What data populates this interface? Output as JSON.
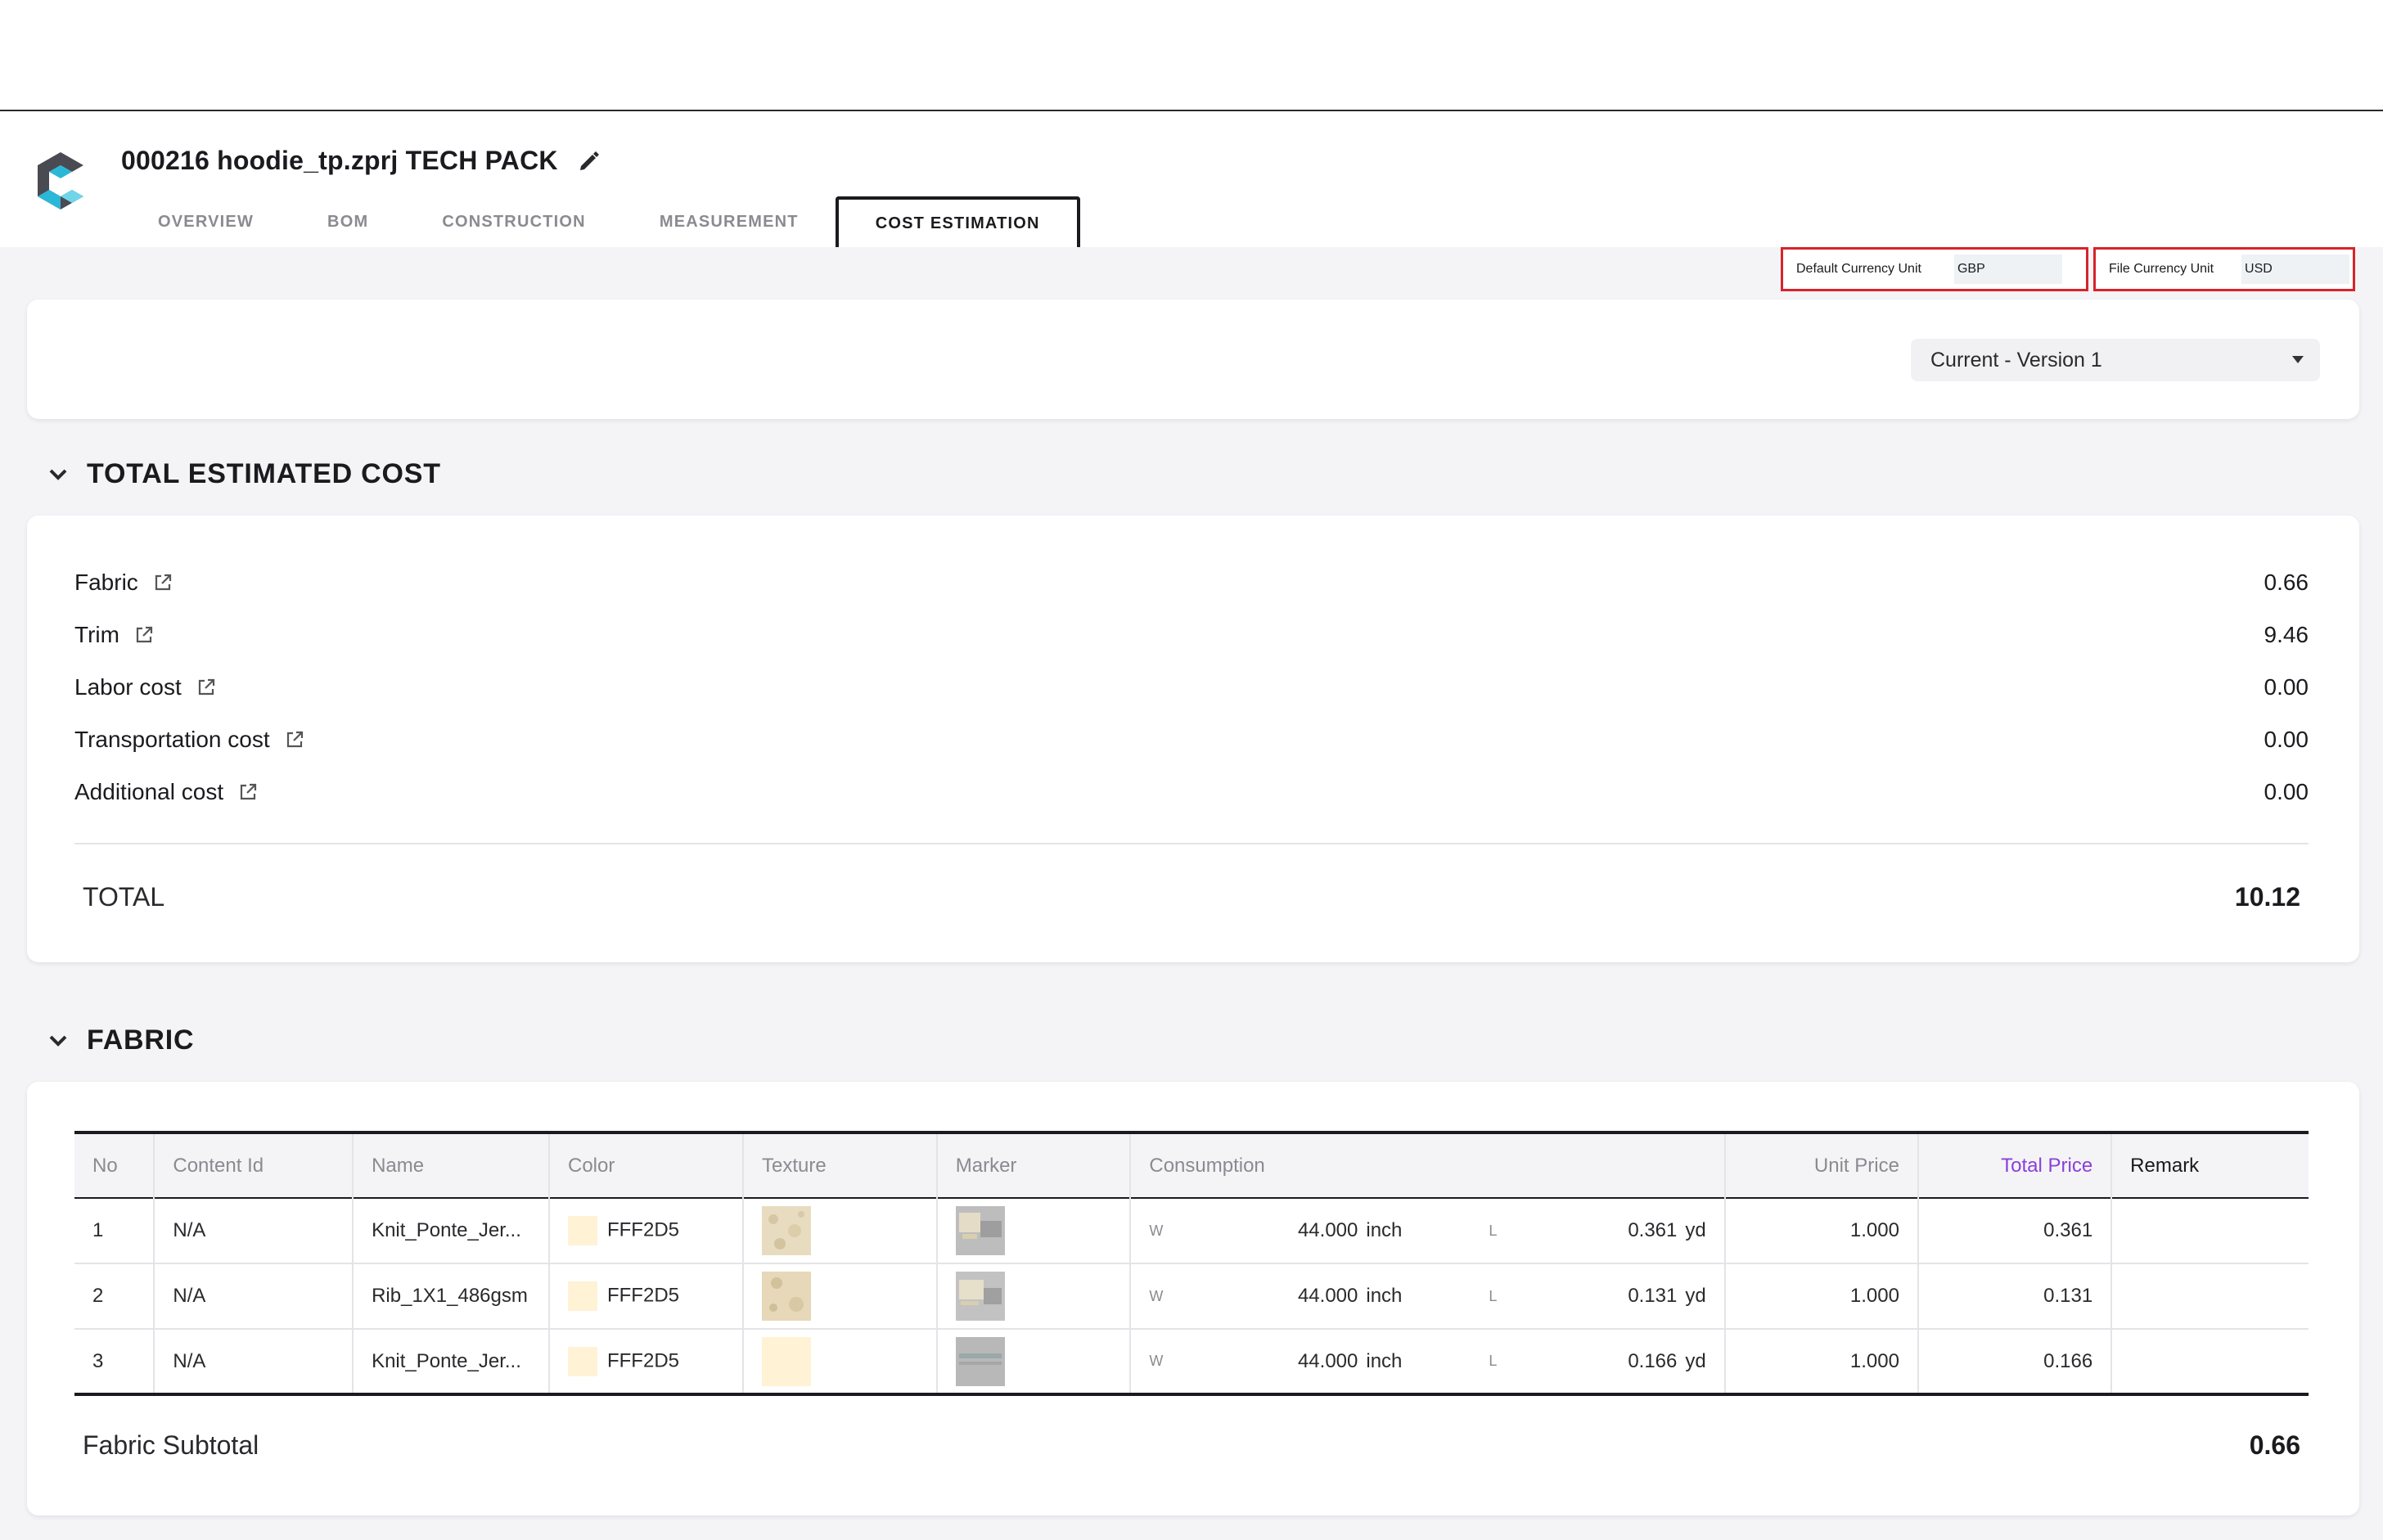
{
  "header": {
    "title": "000216 hoodie_tp.zprj TECH PACK",
    "tabs": [
      {
        "label": "OVERVIEW"
      },
      {
        "label": "BOM"
      },
      {
        "label": "CONSTRUCTION"
      },
      {
        "label": "MEASUREMENT"
      },
      {
        "label": "COST ESTIMATION"
      }
    ]
  },
  "currency": {
    "default_label": "Default Currency Unit",
    "default_value": "GBP",
    "file_label": "File Currency Unit",
    "file_value": "USD"
  },
  "version": {
    "selected": "Current - Version 1"
  },
  "total_estimated_cost": {
    "title": "TOTAL ESTIMATED COST",
    "rows": [
      {
        "label": "Fabric",
        "value": "0.66"
      },
      {
        "label": "Trim",
        "value": "9.46"
      },
      {
        "label": "Labor cost",
        "value": "0.00"
      },
      {
        "label": "Transportation cost",
        "value": "0.00"
      },
      {
        "label": "Additional cost",
        "value": "0.00"
      }
    ],
    "total_label": "TOTAL",
    "total_value": "10.12"
  },
  "fabric": {
    "title": "FABRIC",
    "columns": [
      "No",
      "Content Id",
      "Name",
      "Color",
      "Texture",
      "Marker",
      "Consumption",
      "Unit Price",
      "Total Price",
      "Remark"
    ],
    "rows": [
      {
        "no": "1",
        "content_id": "N/A",
        "name": "Knit_Ponte_Jer...",
        "color": "FFF2D5",
        "w_label": "W",
        "w_value": "44.000",
        "w_unit": "inch",
        "l_label": "L",
        "l_value": "0.361",
        "l_unit": "yd",
        "unit_price": "1.000",
        "total_price": "0.361",
        "remark": ""
      },
      {
        "no": "2",
        "content_id": "N/A",
        "name": "Rib_1X1_486gsm",
        "color": "FFF2D5",
        "w_label": "W",
        "w_value": "44.000",
        "w_unit": "inch",
        "l_label": "L",
        "l_value": "0.131",
        "l_unit": "yd",
        "unit_price": "1.000",
        "total_price": "0.131",
        "remark": ""
      },
      {
        "no": "3",
        "content_id": "N/A",
        "name": "Knit_Ponte_Jer...",
        "color": "FFF2D5",
        "w_label": "W",
        "w_value": "44.000",
        "w_unit": "inch",
        "l_label": "L",
        "l_value": "0.166",
        "l_unit": "yd",
        "unit_price": "1.000",
        "total_price": "0.166",
        "remark": ""
      }
    ],
    "subtotal_label": "Fabric Subtotal",
    "subtotal_value": "0.66"
  },
  "colors": {
    "accent_purple": "#8b3fd9",
    "highlight_red": "#d8232a",
    "swatch": "#fff2d5"
  },
  "icons": [
    "app-logo-icon",
    "pencil-edit-icon",
    "chevron-down-icon",
    "external-link-icon",
    "dropdown-caret-icon"
  ]
}
